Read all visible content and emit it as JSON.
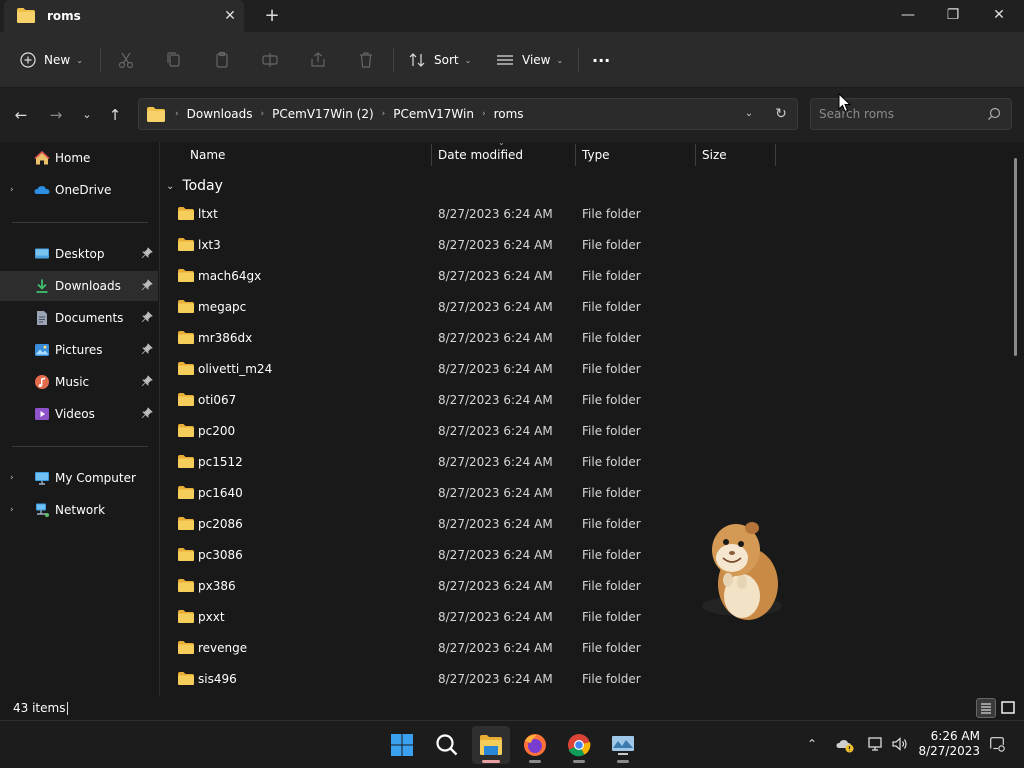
{
  "window": {
    "tab_title": "roms",
    "tab_close": "✕",
    "new_tab": "+",
    "minimize": "—",
    "restore": "❐",
    "close": "✕"
  },
  "toolbar": {
    "new_label": "New",
    "sort_label": "Sort",
    "view_label": "View",
    "more_label": "···",
    "chevron": "⌄"
  },
  "address": {
    "crumbs": [
      "Downloads",
      "PCemV17Win (2)",
      "PCemV17Win",
      "roms"
    ],
    "separator": "›",
    "search_placeholder": "Search roms"
  },
  "sidebar": {
    "items": [
      {
        "label": "Home",
        "icon": "home-icon"
      },
      {
        "label": "OneDrive",
        "icon": "onedrive-icon"
      },
      {
        "label": "Desktop",
        "icon": "desktop-icon"
      },
      {
        "label": "Downloads",
        "icon": "downloads-icon"
      },
      {
        "label": "Documents",
        "icon": "documents-icon"
      },
      {
        "label": "Pictures",
        "icon": "pictures-icon"
      },
      {
        "label": "Music",
        "icon": "music-icon"
      },
      {
        "label": "Videos",
        "icon": "videos-icon"
      },
      {
        "label": "My Computer",
        "icon": "computer-icon"
      },
      {
        "label": "Network",
        "icon": "network-icon"
      }
    ],
    "expander": "›"
  },
  "columns": {
    "name": "Name",
    "date": "Date modified",
    "type": "Type",
    "size": "Size"
  },
  "group": {
    "label": "Today",
    "chevron": "⌄"
  },
  "files": [
    {
      "name": "ltxt",
      "date": "8/27/2023 6:24 AM",
      "type": "File folder"
    },
    {
      "name": "lxt3",
      "date": "8/27/2023 6:24 AM",
      "type": "File folder"
    },
    {
      "name": "mach64gx",
      "date": "8/27/2023 6:24 AM",
      "type": "File folder"
    },
    {
      "name": "megapc",
      "date": "8/27/2023 6:24 AM",
      "type": "File folder"
    },
    {
      "name": "mr386dx",
      "date": "8/27/2023 6:24 AM",
      "type": "File folder"
    },
    {
      "name": "olivetti_m24",
      "date": "8/27/2023 6:24 AM",
      "type": "File folder"
    },
    {
      "name": "oti067",
      "date": "8/27/2023 6:24 AM",
      "type": "File folder"
    },
    {
      "name": "pc200",
      "date": "8/27/2023 6:24 AM",
      "type": "File folder"
    },
    {
      "name": "pc1512",
      "date": "8/27/2023 6:24 AM",
      "type": "File folder"
    },
    {
      "name": "pc1640",
      "date": "8/27/2023 6:24 AM",
      "type": "File folder"
    },
    {
      "name": "pc2086",
      "date": "8/27/2023 6:24 AM",
      "type": "File folder"
    },
    {
      "name": "pc3086",
      "date": "8/27/2023 6:24 AM",
      "type": "File folder"
    },
    {
      "name": "px386",
      "date": "8/27/2023 6:24 AM",
      "type": "File folder"
    },
    {
      "name": "pxxt",
      "date": "8/27/2023 6:24 AM",
      "type": "File folder"
    },
    {
      "name": "revenge",
      "date": "8/27/2023 6:24 AM",
      "type": "File folder"
    },
    {
      "name": "sis496",
      "date": "8/27/2023 6:24 AM",
      "type": "File folder"
    }
  ],
  "status": {
    "items_count": "43 items"
  },
  "taskbar": {
    "time": "6:26 AM",
    "date": "8/27/2023",
    "tray_chevron": "⌃"
  },
  "colors": {
    "folder": "#f0c14b",
    "accent": "#4cc2ff"
  }
}
